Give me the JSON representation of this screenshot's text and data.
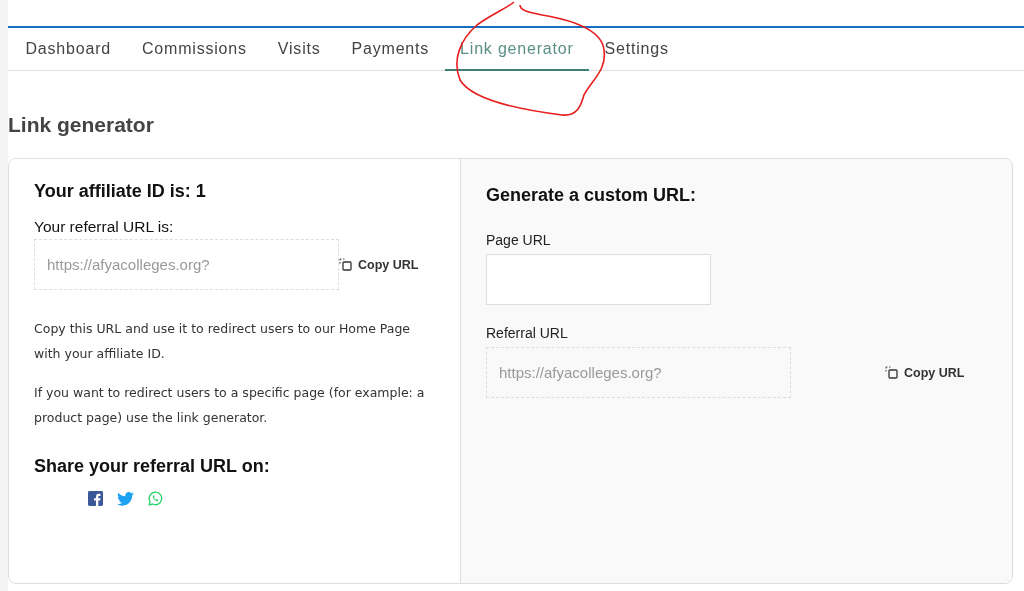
{
  "tabs": [
    {
      "label": "Dashboard",
      "selected": false
    },
    {
      "label": "Commissions",
      "selected": false
    },
    {
      "label": "Visits",
      "selected": false
    },
    {
      "label": "Payments",
      "selected": false
    },
    {
      "label": "Link generator",
      "selected": true
    },
    {
      "label": "Settings",
      "selected": false
    }
  ],
  "page_title": "Link generator",
  "left_panel": {
    "title": "Your affiliate ID is: 1",
    "referral_label": "Your referral URL is:",
    "referral_url": {
      "value": "https://afyacolleges.org?"
    },
    "copy_button": "Copy URL",
    "paragraphs": [
      "Copy this URL and use it to redirect users to our Home Page with your affiliate ID.",
      "If you want to redirect users to a specific page (for example: a product page) use the link generator."
    ],
    "share_title": "Share your referral URL on:",
    "share_icons": [
      {
        "kind": "facebook"
      },
      {
        "kind": "twitter"
      },
      {
        "kind": "whatsapp"
      }
    ]
  },
  "right_panel": {
    "title": "Generate a custom URL:",
    "page_url_label": "Page URL",
    "referral_url_label": "Referral URL",
    "referral_url": {
      "value": "https://afyacolleges.org?"
    },
    "copy_button": "Copy URL"
  }
}
